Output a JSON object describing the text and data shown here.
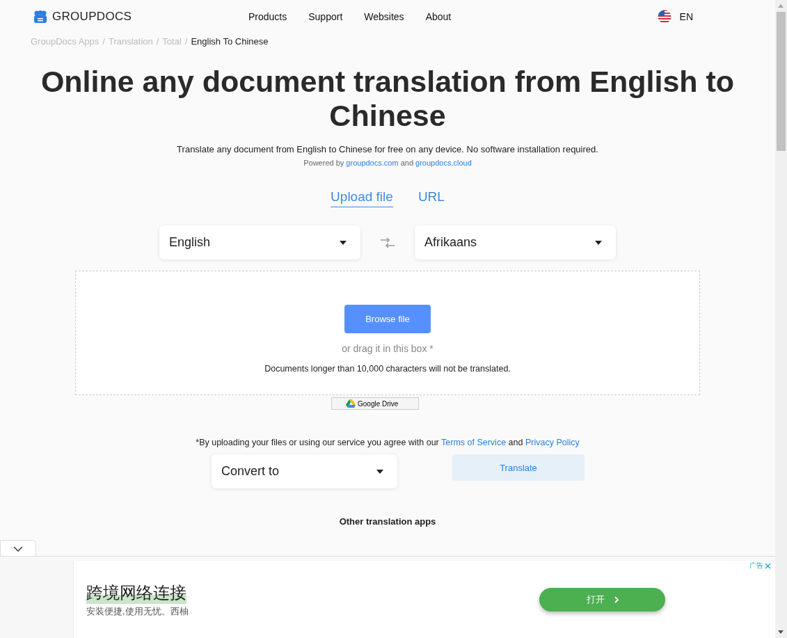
{
  "header": {
    "logo": "GROUPDOCS",
    "nav": [
      "Products",
      "Support",
      "Websites",
      "About"
    ],
    "language": "EN"
  },
  "breadcrumb": [
    {
      "label": "GroupDocs Apps",
      "current": false,
      "separator": "/"
    },
    {
      "label": "Translation",
      "current": false,
      "separator": "/"
    },
    {
      "label": "Total",
      "current": false,
      "separator": "/"
    },
    {
      "label": "English To Chinese",
      "current": true
    }
  ],
  "title": "Online any document translation from English to Chinese",
  "subtitle": "Translate any document from English to Chinese for free on any device. No software installation required.",
  "powered": {
    "text": "Powered by",
    "link1": "groupdocs.com",
    "and": "and",
    "link2": "groupdocs.cloud"
  },
  "tabs": [
    {
      "label": "Upload file",
      "selected": true
    },
    {
      "label": "URL",
      "selected": false
    }
  ],
  "source_language": "English",
  "target_language": "Afrikaans",
  "dropzone": {
    "button": "Browse file",
    "hint": "or drag it in this box *",
    "note": "Documents longer than 10,000 characters will not be translated."
  },
  "google_drive": "Google Drive",
  "terms": {
    "text": "*By uploading your files or using our service you agree with our",
    "link1": "Terms of Service",
    "and": "and",
    "link2": "Privacy Policy"
  },
  "convert_to": "Convert to",
  "translate_button": "Translate",
  "other_apps_heading": "Other translation apps",
  "ad": {
    "label": "广告",
    "headline": "跨境网络连接",
    "tagline": "安装便捷,使用无忧。西柚",
    "button": "打开"
  }
}
